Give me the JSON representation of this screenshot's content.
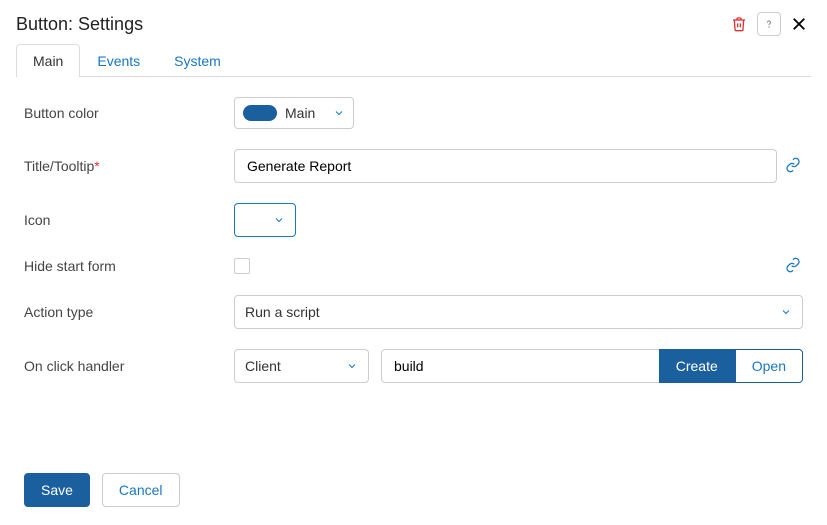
{
  "header": {
    "title": "Button: Settings"
  },
  "tabs": {
    "main": "Main",
    "events": "Events",
    "system": "System"
  },
  "form": {
    "button_color": {
      "label": "Button color",
      "value": "Main"
    },
    "title_tooltip": {
      "label": "Title/Tooltip",
      "value": "Generate Report"
    },
    "icon": {
      "label": "Icon"
    },
    "hide_start": {
      "label": "Hide start form"
    },
    "action_type": {
      "label": "Action type",
      "value": "Run a script"
    },
    "on_click": {
      "label": "On click handler",
      "scope": "Client",
      "handler": "build"
    }
  },
  "buttons": {
    "create": "Create",
    "open": "Open",
    "save": "Save",
    "cancel": "Cancel"
  }
}
